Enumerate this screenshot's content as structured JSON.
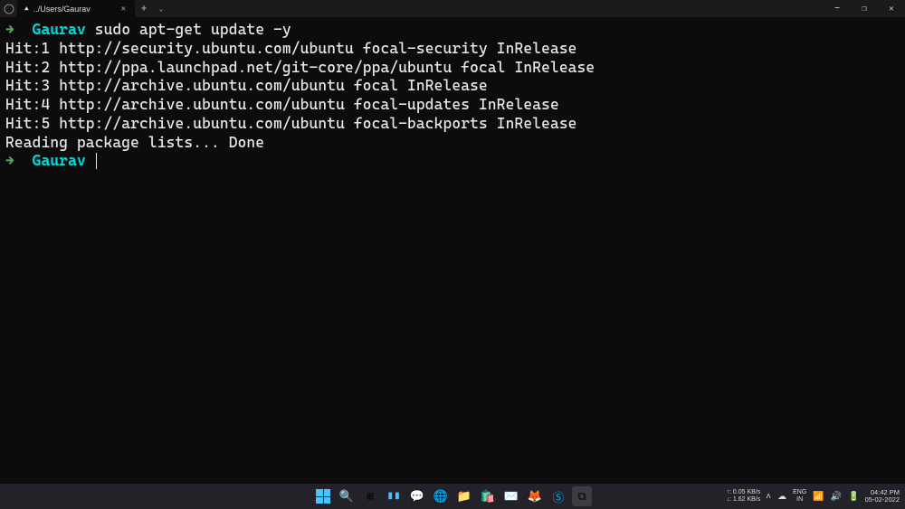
{
  "tab": {
    "title": "../Users/Gaurav"
  },
  "terminal": {
    "prompt_arrow": "→",
    "folder": "Gaurav",
    "command": "sudo apt-get update -y",
    "output": [
      "Hit:1 http://security.ubuntu.com/ubuntu focal-security InRelease",
      "Hit:2 http://ppa.launchpad.net/git-core/ppa/ubuntu focal InRelease",
      "Hit:3 http://archive.ubuntu.com/ubuntu focal InRelease",
      "Hit:4 http://archive.ubuntu.com/ubuntu focal-updates InRelease",
      "Hit:5 http://archive.ubuntu.com/ubuntu focal-backports InRelease",
      "Reading package lists... Done"
    ]
  },
  "systray": {
    "net_up": "↑: 0.05 KB/s",
    "net_down": "↓: 1.62 KB/s",
    "lang1": "ENG",
    "lang2": "IN",
    "time": "04:42 PM",
    "date": "05-02-2022"
  }
}
